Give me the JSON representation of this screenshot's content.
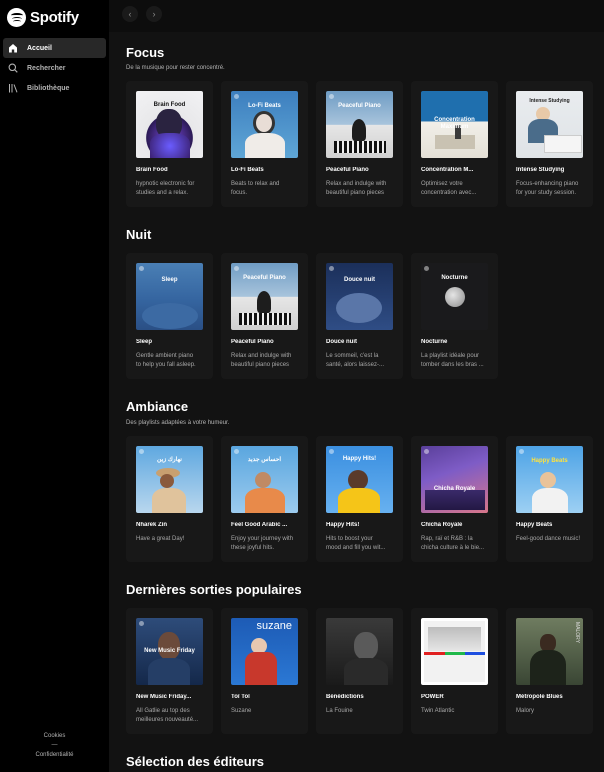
{
  "app": {
    "name": "Spotify"
  },
  "sidebar": {
    "items": [
      {
        "label": "Accueil"
      },
      {
        "label": "Rechercher"
      },
      {
        "label": "Bibliothèque"
      }
    ],
    "footer": {
      "cookies": "Cookies",
      "dash": "—",
      "privacy": "Confidentialité"
    }
  },
  "topbar": {
    "back": "‹",
    "forward": "›"
  },
  "sections": {
    "focus": {
      "title": "Focus",
      "subtitle": "De la musique pour rester concentré.",
      "cards": [
        {
          "cover": "Brain Food",
          "name": "Brain Food",
          "desc1": "hypnotic electronic for",
          "desc2": "studies and a relax."
        },
        {
          "cover": "Lo-Fi Beats",
          "name": "Lo-Fi Beats",
          "desc1": "Beats to relax and",
          "desc2": "focus."
        },
        {
          "cover": "Peaceful Piano",
          "name": "Peaceful Piano",
          "desc1": "Relax and indulge with",
          "desc2": "beautiful piano pieces"
        },
        {
          "cover": "Concentration Maximum",
          "name": "Concentration M...",
          "desc1": "Optimisez votre",
          "desc2": "concentration avec..."
        },
        {
          "cover": "Intense Studying",
          "name": "Intense Studying",
          "desc1": "Focus-enhancing piano",
          "desc2": "for your study session."
        }
      ]
    },
    "nuit": {
      "title": "Nuit",
      "cards": [
        {
          "cover": "Sleep",
          "name": "Sleep",
          "desc1": "Gentle ambient piano",
          "desc2": "to help you fall asleep."
        },
        {
          "cover": "Peaceful Piano",
          "name": "Peaceful Piano",
          "desc1": "Relax and indulge with",
          "desc2": "beautiful piano pieces"
        },
        {
          "cover": "Douce nuit",
          "name": "Douce nuit",
          "desc1": "Le sommeil, c'est la",
          "desc2": "santé, alors laissez-..."
        },
        {
          "cover": "Nocturne",
          "name": "Nocturne",
          "desc1": "La playlist idéale pour",
          "desc2": "tomber dans les bras ..."
        }
      ]
    },
    "ambiance": {
      "title": "Ambiance",
      "subtitle": "Des playlists adaptées à votre humeur.",
      "cards": [
        {
          "cover": "نهارك زين",
          "name": "Nharek Zin",
          "desc1": "Have a great Day!",
          "desc2": ""
        },
        {
          "cover": "احساس جديد",
          "name": "Feel Good Arabic ...",
          "desc1": "Enjoy your journey with",
          "desc2": "these joyful hits."
        },
        {
          "cover": "Happy Hits!",
          "name": "Happy Hits!",
          "desc1": "Hits to boost your",
          "desc2": "mood and fill you wit..."
        },
        {
          "cover": "Chicha Royale",
          "name": "Chicha Royale",
          "desc1": "Rap, raï et R&B : la",
          "desc2": "chicha culture à le bie..."
        },
        {
          "cover": "Happy Beats",
          "name": "Happy Beats",
          "desc1": "Feel-good dance music!",
          "desc2": ""
        }
      ]
    },
    "sorties": {
      "title": "Dernières sorties populaires",
      "cards": [
        {
          "cover": "New Music Friday",
          "name": "New Music Friday...",
          "desc1": "All Gatlie au top des",
          "desc2": "meilleures nouveauté..."
        },
        {
          "cover": "suzane",
          "name": "Toï Toï",
          "desc1": "Suzane",
          "desc2": ""
        },
        {
          "cover": "",
          "name": "Bénédictions",
          "desc1": "La Fouine",
          "desc2": ""
        },
        {
          "cover": "",
          "name": "POWER",
          "desc1": "Twin Atlantic",
          "desc2": ""
        },
        {
          "cover": "MALORY",
          "name": "Métropole Blues",
          "desc1": "Malory",
          "desc2": ""
        }
      ]
    },
    "selection": {
      "title": "Sélection des éditeurs"
    }
  },
  "colors": {
    "background": "#121212",
    "sidebar": "#000000",
    "card": "#181818",
    "muted": "#b3b3b3"
  }
}
